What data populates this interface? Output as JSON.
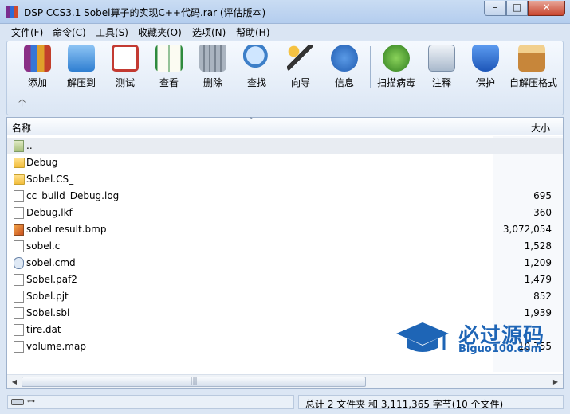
{
  "window": {
    "title": "DSP CCS3.1 Sobel算子的实现C++代码.rar (评估版本)",
    "min_glyph": "–",
    "max_glyph": "□",
    "close_glyph": "✕"
  },
  "menu": [
    "文件(F)",
    "命令(C)",
    "工具(S)",
    "收藏夹(O)",
    "选项(N)",
    "帮助(H)"
  ],
  "toolbar": {
    "items": [
      {
        "label": "添加",
        "icon": "add-archive-icon",
        "color": "#a0428a"
      },
      {
        "label": "解压到",
        "icon": "extract-folder-icon",
        "color": "#2f7fd1"
      },
      {
        "label": "测试",
        "icon": "test-clipboard-icon",
        "color": "#c33a32"
      },
      {
        "label": "查看",
        "icon": "view-book-icon",
        "color": "#2e8a3d"
      },
      {
        "label": "删除",
        "icon": "trash-icon",
        "color": "#8b96a3"
      },
      {
        "label": "查找",
        "icon": "magnifier-icon",
        "color": "#3d7fc8"
      },
      {
        "label": "向导",
        "icon": "wizard-wand-icon",
        "color": "#6b55a8"
      },
      {
        "label": "信息",
        "icon": "info-icon",
        "color": "#2d6bc4"
      },
      {
        "label": "扫描病毒",
        "icon": "virus-scan-icon",
        "color": "#3f9a2b"
      },
      {
        "label": "注释",
        "icon": "comment-icon",
        "color": "#7b8fa8"
      },
      {
        "label": "保护",
        "icon": "shield-icon",
        "color": "#2767c4"
      },
      {
        "label": "自解压格式",
        "icon": "sfx-box-icon",
        "color": "#c7863a"
      }
    ],
    "up_glyph": "🡡"
  },
  "list": {
    "columns": {
      "name": "名称",
      "size": "大小"
    },
    "sort_glyph": "^",
    "rows": [
      {
        "name": "..",
        "size": "",
        "type": "up"
      },
      {
        "name": "Debug",
        "size": "",
        "type": "folder"
      },
      {
        "name": "Sobel.CS_",
        "size": "",
        "type": "folder"
      },
      {
        "name": "cc_build_Debug.log",
        "size": "695",
        "type": "file"
      },
      {
        "name": "Debug.lkf",
        "size": "360",
        "type": "file"
      },
      {
        "name": "sobel result.bmp",
        "size": "3,072,054",
        "type": "bmp"
      },
      {
        "name": "sobel.c",
        "size": "1,528",
        "type": "file"
      },
      {
        "name": "sobel.cmd",
        "size": "1,209",
        "type": "cmd"
      },
      {
        "name": "Sobel.paf2",
        "size": "1,479",
        "type": "file"
      },
      {
        "name": "Sobel.pjt",
        "size": "852",
        "type": "file"
      },
      {
        "name": "Sobel.sbl",
        "size": "1,939",
        "type": "file"
      },
      {
        "name": "tire.dat",
        "size": "",
        "type": "file"
      },
      {
        "name": "volume.map",
        "size": "10,755",
        "type": "file"
      }
    ],
    "scroll_left": "◀",
    "scroll_right": "▶",
    "scroll_grip": "|||"
  },
  "status": {
    "summary": "总计 2 文件夹 和 3,111,365 字节(10 个文件)",
    "key_glyph": "⊶"
  },
  "watermark": {
    "title": "必过源码",
    "subtitle": "Biguo100.com"
  }
}
